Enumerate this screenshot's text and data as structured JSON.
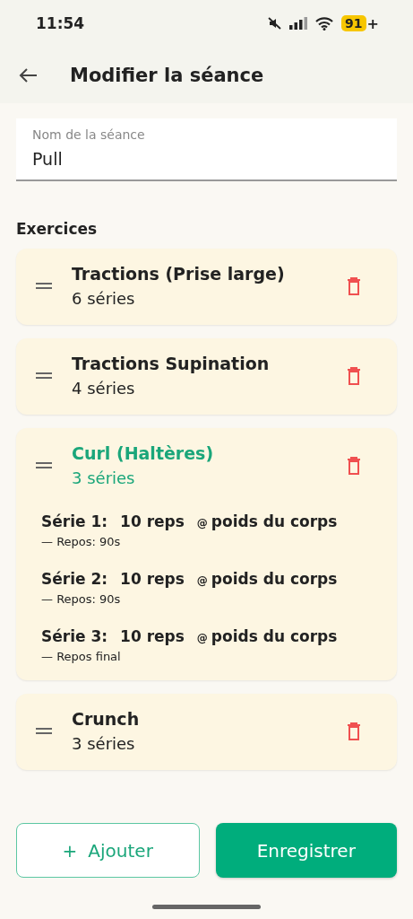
{
  "status_bar": {
    "time": "11:54",
    "battery": "91",
    "battery_suffix": "+"
  },
  "app_bar": {
    "title": "Modifier la séance"
  },
  "name_field": {
    "label": "Nom de la séance",
    "value": "Pull"
  },
  "section_title": "Exercices",
  "exercises": [
    {
      "name": "Tractions (Prise large)",
      "count": "6 séries",
      "expanded": false
    },
    {
      "name": "Tractions Supination",
      "count": "4 séries",
      "expanded": false
    },
    {
      "name": "Curl (Haltères)",
      "count": "3 séries",
      "expanded": true,
      "sets": [
        {
          "label": "Série 1:",
          "reps": "10 reps",
          "at": "@",
          "weight": "poids du corps",
          "rest": "— Repos: 90s"
        },
        {
          "label": "Série 2:",
          "reps": "10 reps",
          "at": "@",
          "weight": "poids du corps",
          "rest": "— Repos: 90s"
        },
        {
          "label": "Série 3:",
          "reps": "10 reps",
          "at": "@",
          "weight": "poids du corps",
          "rest": "— Repos final"
        }
      ]
    },
    {
      "name": "Crunch",
      "count": "3 séries",
      "expanded": false
    }
  ],
  "buttons": {
    "add": {
      "icon": "+",
      "label": "Ajouter"
    },
    "save": {
      "label": "Enregistrer"
    }
  }
}
